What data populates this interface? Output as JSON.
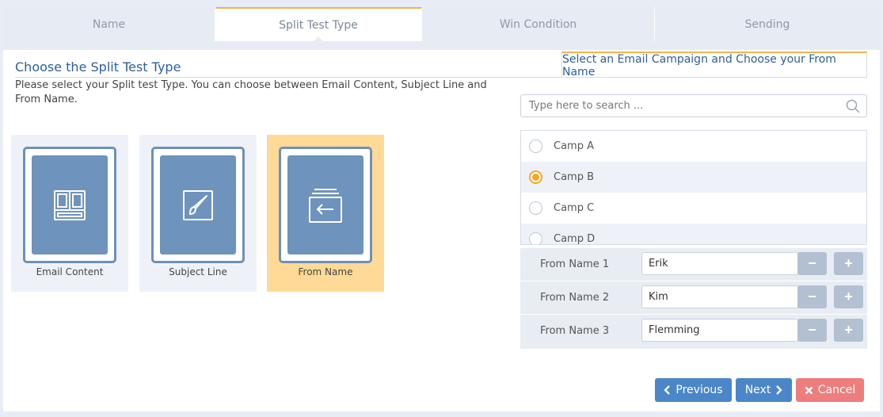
{
  "tabs": [
    {
      "label": "Name",
      "active": false
    },
    {
      "label": "Split Test Type",
      "active": true
    },
    {
      "label": "Win Condition",
      "active": false
    },
    {
      "label": "Sending",
      "active": false
    }
  ],
  "left": {
    "title": "Choose the Split Test Type",
    "description": "Please select your Split test Type. You can choose between Email Content, Subject Line and From Name.",
    "types": [
      {
        "label": "Email Content",
        "icon": "layout-icon",
        "selected": false
      },
      {
        "label": "Subject Line",
        "icon": "brush-icon",
        "selected": false
      },
      {
        "label": "From Name",
        "icon": "inbox-arrow-icon",
        "selected": true
      }
    ]
  },
  "right": {
    "tab_label": "Select an Email Campaign and Choose your From Name",
    "search_placeholder": "Type here to search ...",
    "campaigns": [
      {
        "label": "Camp A",
        "checked": false
      },
      {
        "label": "Camp B",
        "checked": true
      },
      {
        "label": "Camp C",
        "checked": false
      },
      {
        "label": "Camp D",
        "checked": false
      }
    ],
    "from_names": [
      {
        "label": "From Name 1",
        "value": "Erik"
      },
      {
        "label": "From Name 2",
        "value": "Kim"
      },
      {
        "label": "From Name 3",
        "value": "Flemming"
      }
    ]
  },
  "buttons": {
    "previous": "Previous",
    "next": "Next",
    "cancel": "Cancel"
  },
  "colors": {
    "accent": "#f3b34c",
    "primary": "#4b86c9",
    "danger": "#ee7d7d",
    "selected_card": "#ffd996"
  }
}
